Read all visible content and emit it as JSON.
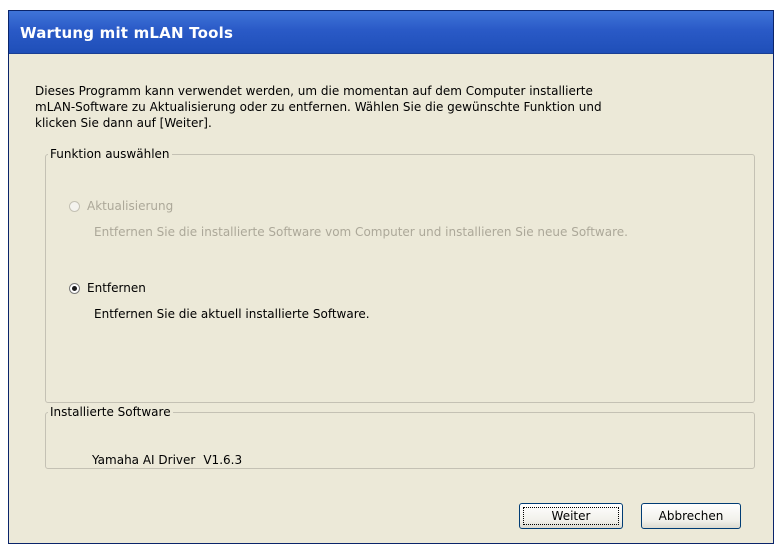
{
  "window": {
    "title": "Wartung mit mLAN Tools"
  },
  "description": {
    "line1": "Dieses Programm kann verwendet werden, um die momentan auf dem Computer installierte",
    "line2": "mLAN-Software zu Aktualisierung oder zu entfernen. Wählen Sie die gewünschte Funktion und",
    "line3": "klicken Sie dann auf [Weiter]."
  },
  "function_group": {
    "legend": "Funktion auswählen",
    "options": [
      {
        "label": "Aktualisierung",
        "description": "Entfernen Sie die installierte Software vom Computer und installieren Sie neue Software.",
        "enabled": false,
        "selected": false
      },
      {
        "label": "Entfernen",
        "description": "Entfernen Sie die aktuell installierte Software.",
        "enabled": true,
        "selected": true
      }
    ]
  },
  "installed_group": {
    "legend": "Installierte Software",
    "software_name": "Yamaha AI Driver",
    "software_version": "V1.6.3"
  },
  "buttons": {
    "next_label": "Weiter",
    "cancel_label": "Abbrechen"
  },
  "colors": {
    "titlebar": "#2a5ac7",
    "dialog_background": "#ece9d8",
    "disabled_text": "#aca899"
  }
}
